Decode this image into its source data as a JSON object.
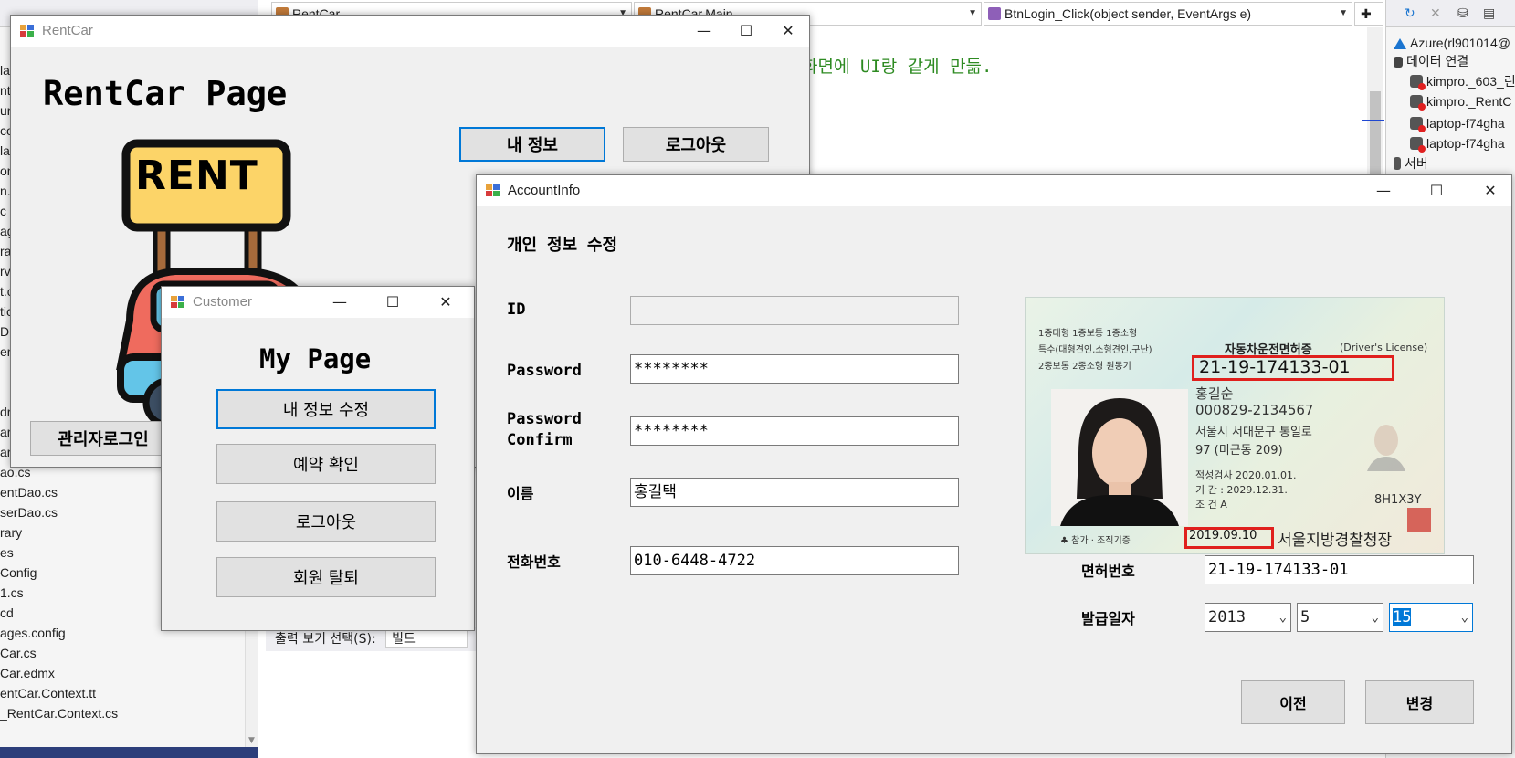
{
  "vs_solution": {
    "lines": [
      "la",
      "nt(",
      "ur",
      "co",
      "la",
      "on",
      "n.c",
      "c",
      "ag",
      "ra",
      "rv",
      "t.c",
      "tic",
      "D",
      "er",
      "",
      "",
      "dr",
      "ar",
      "arTypeDao.cs",
      "ao.cs",
      "entDao.cs",
      "serDao.cs",
      "rary",
      "es",
      "Config",
      "1.cs",
      "cd",
      "ages.config",
      "Car.cs",
      "Car.edmx",
      "entCar.Context.tt",
      "_RentCar.Context.cs"
    ]
  },
  "vs_editor": {
    "project_combo": "RentCar",
    "class_combo": "RentCar.Main",
    "member_combo": "BtnLogin_Click(object sender, EventArgs e)",
    "code_comment": "화면에 UI랑 같게 만듦.",
    "output_label": "출력 보기 선택(S):",
    "output_value": "빌드"
  },
  "vs_server": {
    "items": [
      {
        "icon": "azure-icon",
        "label": "Azure(rl901014@"
      },
      {
        "icon": "data-connection-icon",
        "label": "데이터 연결"
      },
      {
        "icon": "database-error-icon",
        "label": "kimpro._603_린"
      },
      {
        "icon": "database-error-icon",
        "label": "kimpro._RentC"
      },
      {
        "icon": "database-error-icon",
        "label": "laptop-f74gha"
      },
      {
        "icon": "database-error-icon",
        "label": "laptop-f74gha"
      },
      {
        "icon": "server-icon",
        "label": "서버"
      }
    ]
  },
  "rentcar_window": {
    "title": "RentCar",
    "heading": "RentCar Page",
    "logo_text": "RENT",
    "my_info_button": "내 정보",
    "logout_button": "로그아웃",
    "admin_login_button": "관리자로그인"
  },
  "customer_window": {
    "title": "Customer",
    "heading": "My Page",
    "buttons": [
      "내 정보 수정",
      "예약 확인",
      "로그아웃",
      "회원 탈퇴"
    ]
  },
  "account_window": {
    "title": "AccountInfo",
    "heading": "개인 정보 수정",
    "id_label": "ID",
    "id_value": "",
    "password_label": "Password",
    "password_value": "********",
    "password_confirm_label_1": "Password",
    "password_confirm_label_2": "Confirm",
    "password_confirm_value": "********",
    "name_label": "이름",
    "name_value": "홍길택",
    "phone_label": "전화번호",
    "phone_value": "010-6448-4722",
    "license_no_label": "면허번호",
    "license_no_value": "21-19-174133-01",
    "issue_date_label": "발급일자",
    "issue_year": "2013",
    "issue_month": "5",
    "issue_day": "15",
    "prev_button": "이전",
    "change_button": "변경",
    "license_card": {
      "header_left_1": "1종대형  1종보통  1종소형",
      "header_left_2": "특수(대형견인,소형견인,구난)",
      "header_left_3": "2종보통 2종소형 원동기",
      "card_title": "자동차운전면허증",
      "card_title_en": "(Driver's License)",
      "license_number": "21-19-174133-01",
      "name": "홍길순",
      "rrn": "000829-2134567",
      "address_1": "서울시 서대문구 통일로",
      "address_2": "97 (미근동 209)",
      "inspection": "적성검사  2020.01.01.",
      "period": "기    간 : 2029.12.31.",
      "condition": "조    건 A",
      "serial": "8H1X3Y",
      "issue_date": "2019.09.10",
      "issuer": "서울지방경찰청장",
      "footer_left": "♣ 참가 · 조직기증"
    }
  }
}
